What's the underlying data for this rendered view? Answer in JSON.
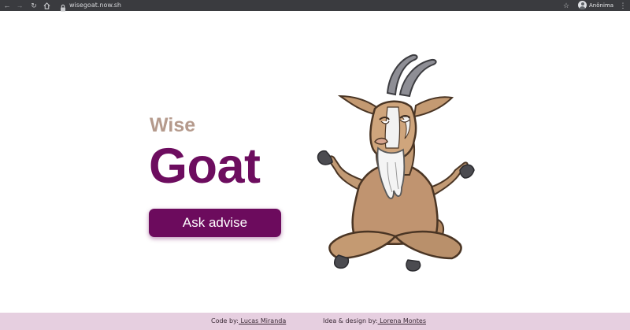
{
  "browser": {
    "url": "wisegoat.now.sh",
    "profile_name": "Anônima",
    "icons": [
      "back-arrow-icon",
      "forward-arrow-icon",
      "reload-icon",
      "home-icon",
      "lock-icon",
      "star-icon",
      "profile-avatar-icon",
      "more-menu-icon"
    ]
  },
  "hero": {
    "subtitle": "Wise",
    "title": "Goat",
    "button_label": "Ask advise",
    "illustration": "meditating-goat-illustration"
  },
  "footer": {
    "code_prefix": "Code by:",
    "code_author": " Lucas Miranda",
    "design_prefix": "Idea & design by:",
    "design_author": " Lorena Montes"
  },
  "colors": {
    "brand_purple": "#6c0b5d",
    "subtitle_tan": "#b59a8c",
    "footer_background": "#e6cfe0",
    "chrome_background": "#3a3b3f"
  }
}
